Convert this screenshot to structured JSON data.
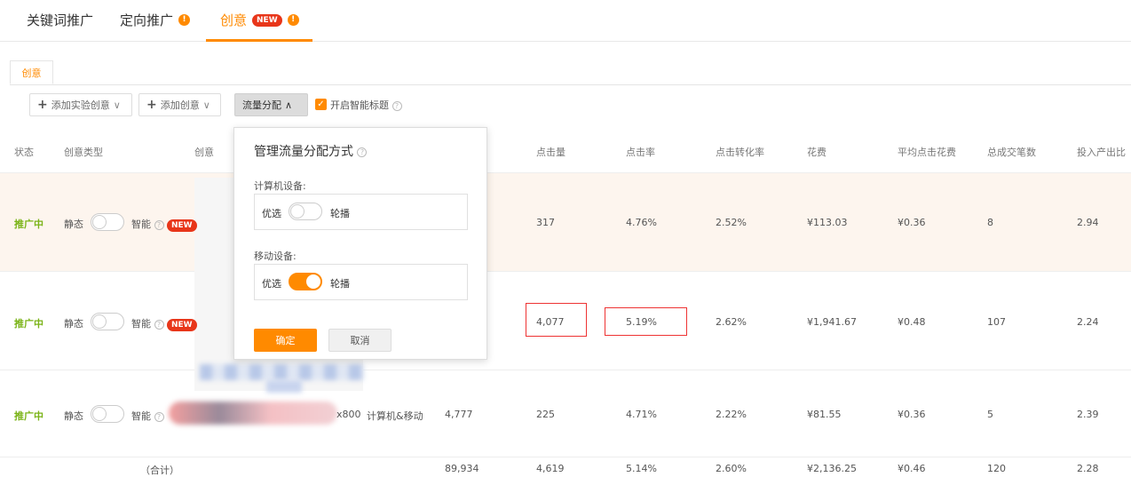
{
  "top_tabs": [
    {
      "label": "关键词推广"
    },
    {
      "label": "定向推广"
    },
    {
      "label": "创意",
      "badge": "NEW"
    }
  ],
  "sub_tab": {
    "label": "创意"
  },
  "toolbar": {
    "add_experiment": "添加实验创意",
    "add_creative": "添加创意",
    "traffic": "流量分配",
    "smart_title": "开启智能标题"
  },
  "columns": {
    "status": "状态",
    "type": "创意类型",
    "creative": "创意",
    "clicks": "点击量",
    "ctr": "点击率",
    "cvr": "点击转化率",
    "cost": "花费",
    "cpc": "平均点击花费",
    "orders": "总成交笔数",
    "roi": "投入产出比"
  },
  "type_labels": {
    "static": "静态",
    "smart": "智能",
    "new": "NEW"
  },
  "rows": [
    {
      "status": "推广中",
      "clicks": "317",
      "ctr": "4.76%",
      "cvr": "2.52%",
      "cost": "¥113.03",
      "cpc": "¥0.36",
      "orders": "8",
      "roi": "2.94"
    },
    {
      "status": "推广中",
      "clicks": "4,077",
      "ctr": "5.19%",
      "cvr": "2.62%",
      "cost": "¥1,941.67",
      "cpc": "¥0.48",
      "orders": "107",
      "roi": "2.24"
    },
    {
      "status": "推广中",
      "size_tail": "x800",
      "device": "计算机&移动",
      "impressions": "4,777",
      "clicks": "225",
      "ctr": "4.71%",
      "cvr": "2.22%",
      "cost": "¥81.55",
      "cpc": "¥0.36",
      "orders": "5",
      "roi": "2.39"
    }
  ],
  "total": {
    "label": "（合计）",
    "impressions": "89,934",
    "clicks": "4,619",
    "ctr": "5.14%",
    "cvr": "2.60%",
    "cost": "¥2,136.25",
    "cpc": "¥0.46",
    "orders": "120",
    "roi": "2.28"
  },
  "popover": {
    "title": "管理流量分配方式",
    "pc_label": "计算机设备:",
    "mobile_label": "移动设备:",
    "prefer": "优选",
    "rotate": "轮播",
    "pc_mode": "优选",
    "mobile_mode": "轮播",
    "ok": "确定",
    "cancel": "取消"
  },
  "colors": {
    "accent": "#ff8a00",
    "status_green": "#7ab317",
    "badge_red": "#e8361a",
    "highlight_red": "#e33333"
  }
}
